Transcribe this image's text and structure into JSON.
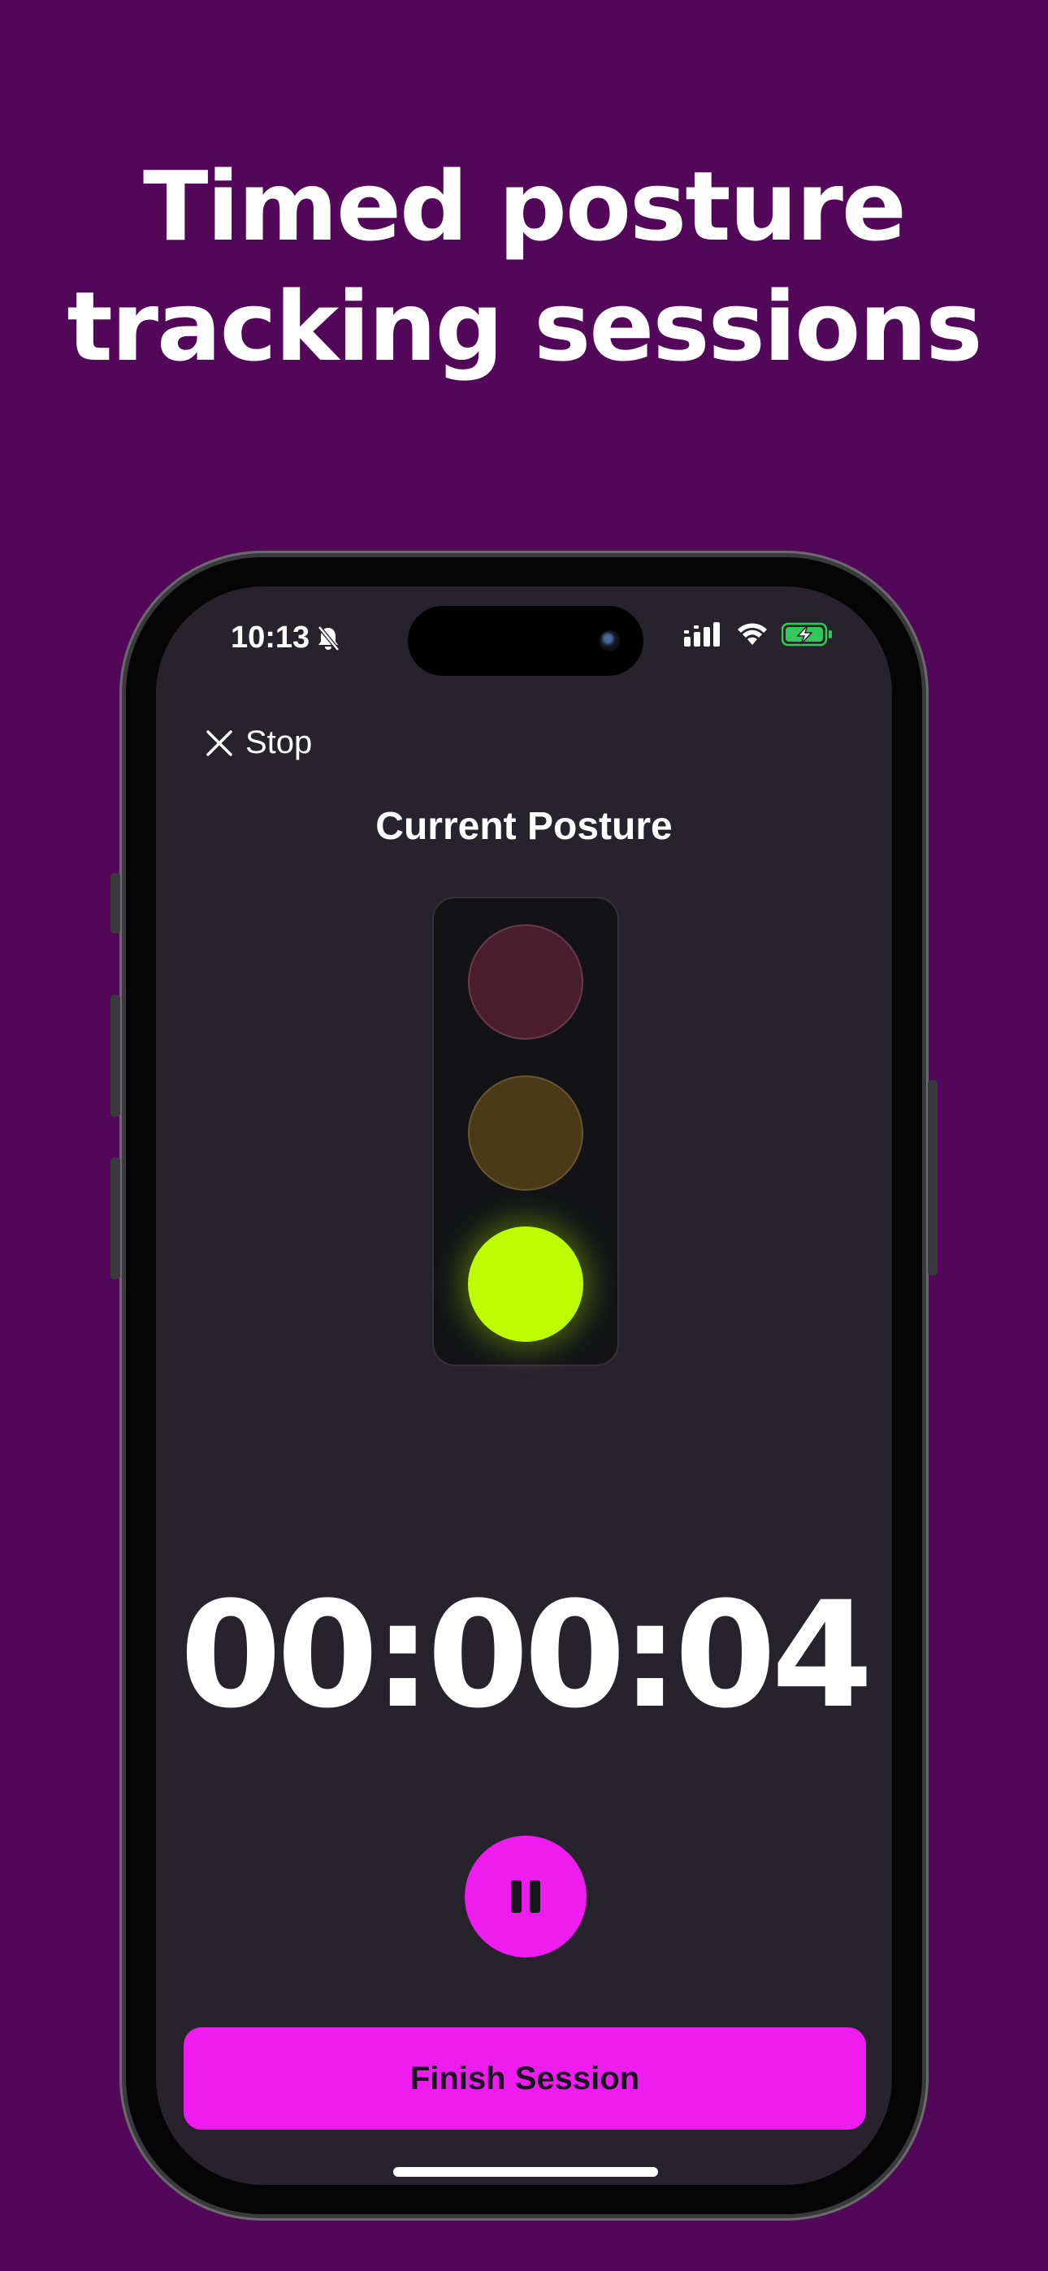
{
  "headline": {
    "line1": "Timed posture",
    "line2": "tracking sessions"
  },
  "status_bar": {
    "time": "10:13",
    "icons": [
      "bell-slash-icon",
      "signal-icon",
      "wifi-icon",
      "battery-charging-icon"
    ]
  },
  "nav": {
    "stop_label": "Stop",
    "stop_icon": "close-icon"
  },
  "posture": {
    "title": "Current Posture",
    "active_light": "green",
    "colors": {
      "red_off": "#4a1d2d",
      "yellow_off": "#4a3a18",
      "green_on": "#bdff00"
    }
  },
  "timer": {
    "value": "00:00:04"
  },
  "controls": {
    "pause_icon": "pause-icon",
    "finish_label": "Finish Session",
    "accent_color": "#ef1cf0"
  },
  "theme": {
    "background": "#520759",
    "screen": "#26232d"
  }
}
